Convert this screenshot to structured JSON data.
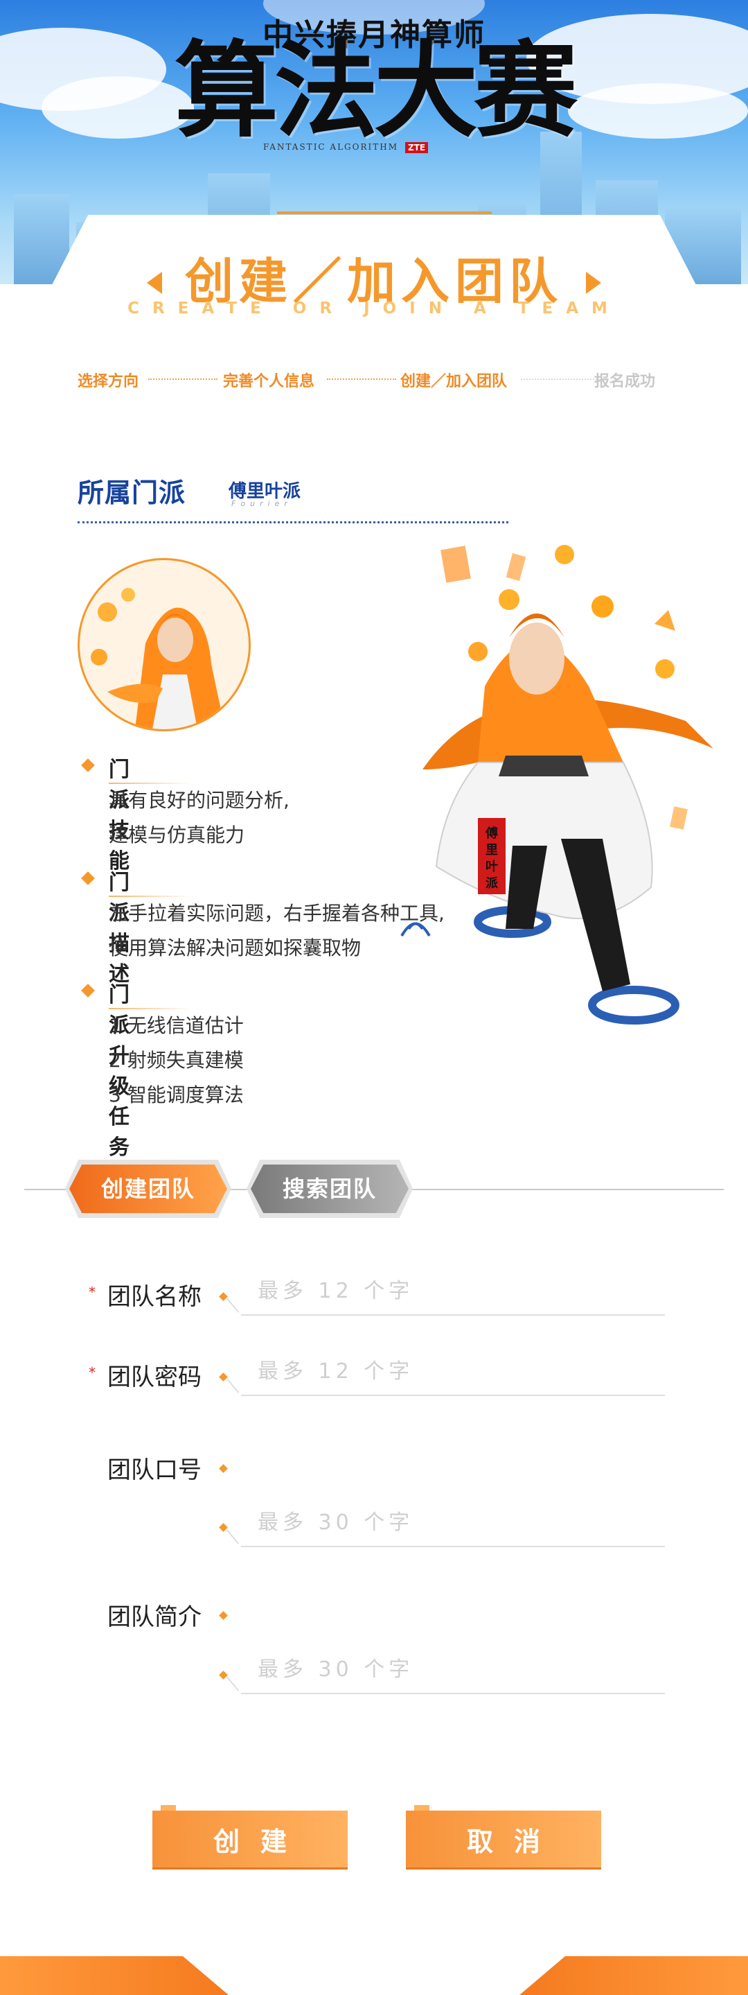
{
  "hero": {
    "subtitle": "中兴捧月神算师",
    "title": "算法大赛",
    "english": "FANTASTIC ALGORITHM",
    "brand": "ZTE"
  },
  "section": {
    "title": "创建／加入团队",
    "english": "CREATE OR JOIN A TEAM"
  },
  "steps": [
    {
      "label": "选择方向",
      "state": "done"
    },
    {
      "label": "完善个人信息",
      "state": "done"
    },
    {
      "label": "创建／加入团队",
      "state": "current"
    },
    {
      "label": "报名成功",
      "state": "pending"
    }
  ],
  "faction": {
    "label": "所属门派",
    "name": "傅里叶派",
    "name_en": "Fourier",
    "banner": "傅里叶派"
  },
  "info": {
    "skill": {
      "heading": "门派技能",
      "lines": [
        "具有良好的问题分析,",
        "建模与仿真能力"
      ]
    },
    "desc": {
      "heading": "门派描述",
      "lines": [
        "左手拉着实际问题，右手握着各种工具,",
        "使用算法解决问题如探囊取物"
      ]
    },
    "tasks": {
      "heading": "门派升级任务",
      "lines": [
        "1 无线信道估计",
        "2 射频失真建模",
        "3 智能调度算法"
      ]
    }
  },
  "tabs": {
    "create": "创建团队",
    "search": "搜索团队"
  },
  "form": {
    "name_label": "团队名称",
    "name_placeholder": "最多 12 个字",
    "password_label": "团队密码",
    "password_placeholder": "最多 12 个字",
    "slogan_label": "团队口号",
    "slogan_placeholder": "最多 30 个字",
    "intro_label": "团队简介",
    "intro_placeholder": "最多 30 个字",
    "required_mark": "*"
  },
  "buttons": {
    "create": "创建",
    "cancel": "取消"
  },
  "colors": {
    "accent": "#f5982b",
    "faction_blue": "#17439c",
    "required": "#e0251d"
  }
}
